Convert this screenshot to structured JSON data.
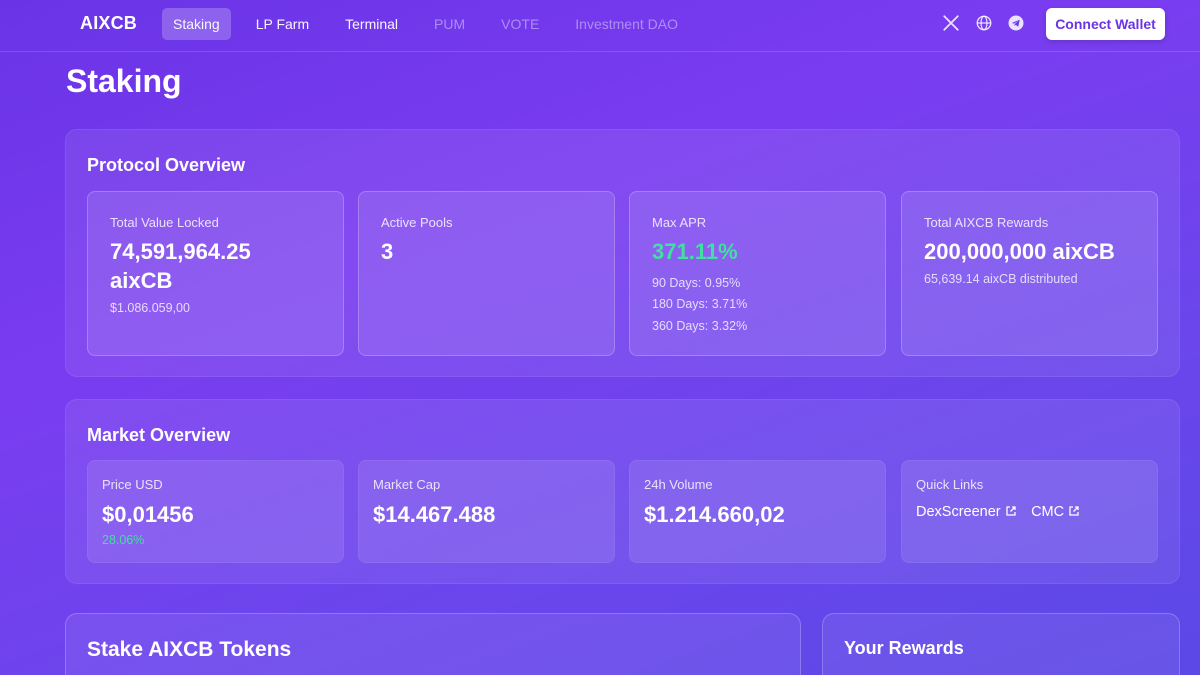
{
  "nav": {
    "logo": "AIXCB",
    "links": [
      {
        "label": "Staking"
      },
      {
        "label": "LP Farm"
      },
      {
        "label": "Terminal"
      },
      {
        "label": "PUM"
      },
      {
        "label": "VOTE"
      },
      {
        "label": "Investment DAO"
      }
    ],
    "connect_label": "Connect Wallet"
  },
  "page": {
    "title": "Staking"
  },
  "protocol": {
    "title": "Protocol Overview",
    "tvl": {
      "label": "Total Value Locked",
      "value_line1": "74,591,964.25",
      "value_line2": "aixCB",
      "sub": "$1.086.059,00"
    },
    "pools": {
      "label": "Active Pools",
      "value": "3"
    },
    "apr": {
      "label": "Max APR",
      "value": "371.11%",
      "lines": [
        "90 Days: 0.95%",
        "180 Days: 3.71%",
        "360 Days: 3.32%"
      ]
    },
    "rewards": {
      "label": "Total AIXCB Rewards",
      "value": "200,000,000 aixCB",
      "sub": "65,639.14 aixCB distributed"
    }
  },
  "market": {
    "title": "Market Overview",
    "price": {
      "label": "Price USD",
      "value": "$0,01456",
      "change": "28.06%"
    },
    "cap": {
      "label": "Market Cap",
      "value": "$14.467.488"
    },
    "volume": {
      "label": "24h Volume",
      "value": "$1.214.660,02"
    },
    "quick_links": {
      "label": "Quick Links",
      "items": [
        "DexScreener",
        "CMC"
      ]
    }
  },
  "stake": {
    "title": "Stake AIXCB Tokens"
  },
  "rewards_panel": {
    "title": "Your Rewards"
  },
  "colors": {
    "accent": "#6a34e6",
    "positive": "#3fe0a0"
  },
  "icons": [
    "x-icon",
    "globe-icon",
    "telegram-icon",
    "external-link-icon"
  ]
}
